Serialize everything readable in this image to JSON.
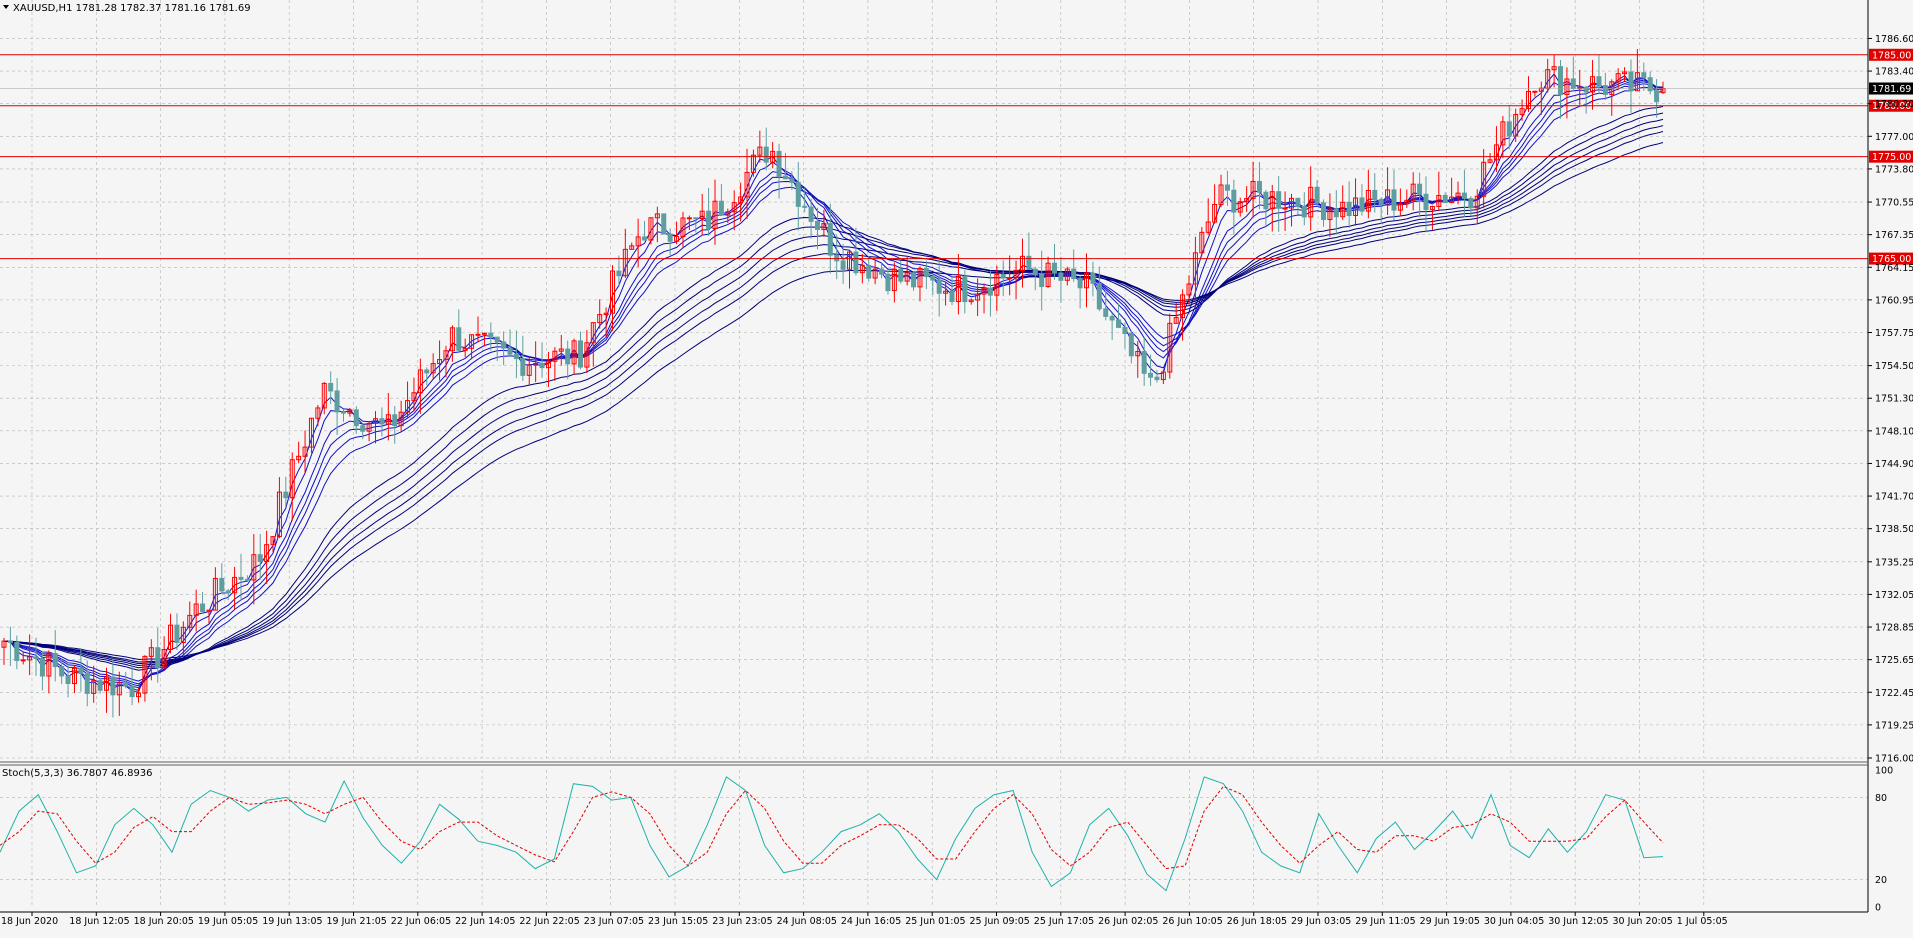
{
  "header": {
    "symbol_label": "XAUUSD,H1  1781.28 1782.37 1781.16 1781.69",
    "arrow_icon": "triangle-down-icon"
  },
  "colors": {
    "background": "#f5f5f5",
    "grid": "#b4b4b4",
    "bull": "#ff0000",
    "bear": "#5f9ea0",
    "ribbon": "#1010c8",
    "ribbon_dark": "#00007a",
    "level": "#e00000",
    "stoch_main": "#20b2aa",
    "stoch_signal": "#e00000",
    "axis": "#000000"
  },
  "chart_data": [
    {
      "type": "candlestick",
      "title": "XAUUSD,H1  1781.28 1782.37 1781.16 1781.69",
      "ohlc_last": {
        "open": 1781.28,
        "high": 1782.37,
        "low": 1781.16,
        "close": 1781.69
      },
      "ylim": [
        1716.0,
        1789.0
      ],
      "y_ticks": [
        "1786.60",
        "1783.40",
        "1780.20",
        "1777.00",
        "1773.80",
        "1770.55",
        "1767.35",
        "1764.15",
        "1760.95",
        "1757.75",
        "1754.50",
        "1751.30",
        "1748.10",
        "1744.90",
        "1741.70",
        "1738.50",
        "1735.25",
        "1732.05",
        "1728.85",
        "1725.65",
        "1722.45",
        "1719.25",
        "1716.00"
      ],
      "x_ticks": [
        "18 Jun 2020",
        "18 Jun 12:05",
        "18 Jun 20:05",
        "19 Jun 05:05",
        "19 Jun 13:05",
        "19 Jun 21:05",
        "22 Jun 06:05",
        "22 Jun 14:05",
        "22 Jun 22:05",
        "23 Jun 07:05",
        "23 Jun 15:05",
        "23 Jun 23:05",
        "24 Jun 08:05",
        "24 Jun 16:05",
        "25 Jun 01:05",
        "25 Jun 09:05",
        "25 Jun 17:05",
        "26 Jun 02:05",
        "26 Jun 10:05",
        "26 Jun 18:05",
        "29 Jun 03:05",
        "29 Jun 11:05",
        "29 Jun 19:05",
        "30 Jun 04:05",
        "30 Jun 12:05",
        "30 Jun 20:05",
        "1 Jul 05:05"
      ],
      "horizontal_levels": [
        {
          "price": 1785.0,
          "label": "1785.00"
        },
        {
          "price": 1780.0,
          "label": "1780.00"
        },
        {
          "price": 1775.0,
          "label": "1775.00"
        },
        {
          "price": 1765.0,
          "label": "1765.00"
        }
      ],
      "current_price": {
        "price": 1781.69,
        "label": "1781.69"
      },
      "path_points": [
        {
          "x": "18 Jun 2020",
          "y": 1727.5
        },
        {
          "x": "18 Jun 12:05",
          "y": 1724.0
        },
        {
          "x": "18 Jun 20:05",
          "y": 1723.0
        },
        {
          "x": "19 Jun 05:05",
          "y": 1730.5
        },
        {
          "x": "19 Jun 13:05",
          "y": 1735.5
        },
        {
          "x": "19 Jun 21:05",
          "y": 1752.0
        },
        {
          "x": "22 Jun 06:05",
          "y": 1748.0
        },
        {
          "x": "22 Jun 14:05",
          "y": 1757.5
        },
        {
          "x": "22 Jun 22:05",
          "y": 1755.0
        },
        {
          "x": "23 Jun 07:05",
          "y": 1755.5
        },
        {
          "x": "23 Jun 15:05",
          "y": 1768.0
        },
        {
          "x": "23 Jun 23:05",
          "y": 1768.5
        },
        {
          "x": "24 Jun 08:05",
          "y": 1776.0
        },
        {
          "x": "24 Jun 16:05",
          "y": 1766.0
        },
        {
          "x": "25 Jun 01:05",
          "y": 1763.0
        },
        {
          "x": "25 Jun 09:05",
          "y": 1762.0
        },
        {
          "x": "25 Jun 17:05",
          "y": 1764.0
        },
        {
          "x": "26 Jun 02:05",
          "y": 1762.0
        },
        {
          "x": "26 Jun 10:05",
          "y": 1752.0
        },
        {
          "x": "26 Jun 18:05",
          "y": 1771.0
        },
        {
          "x": "29 Jun 03:05",
          "y": 1771.0
        },
        {
          "x": "29 Jun 11:05",
          "y": 1770.0
        },
        {
          "x": "29 Jun 19:05",
          "y": 1771.0
        },
        {
          "x": "30 Jun 04:05",
          "y": 1771.5
        },
        {
          "x": "30 Jun 12:05",
          "y": 1783.0
        },
        {
          "x": "30 Jun 20:05",
          "y": 1782.0
        },
        {
          "x": "1 Jul 05:05",
          "y": 1781.69
        }
      ],
      "ribbon": "12 moving averages (blue)"
    },
    {
      "type": "line",
      "title": "Stoch(5,3,3) 36.7807 46.8936",
      "ylim": [
        0,
        100
      ],
      "y_ticks": [
        "100",
        "80",
        "20",
        "0"
      ],
      "series": [
        {
          "role": "main",
          "last": 36.7807,
          "values": [
            40,
            70,
            82,
            55,
            25,
            30,
            60,
            72,
            60,
            40,
            75,
            85,
            80,
            70,
            78,
            80,
            68,
            62,
            92,
            65,
            45,
            32,
            48,
            75,
            64,
            48,
            45,
            40,
            28,
            35,
            90,
            88,
            78,
            80,
            45,
            22,
            30,
            60,
            95,
            85,
            45,
            25,
            28,
            40,
            55,
            60,
            68,
            55,
            35,
            20,
            50,
            72,
            82,
            85,
            40,
            15,
            25,
            60,
            72,
            52,
            24,
            12,
            50,
            95,
            90,
            70,
            40,
            30,
            25,
            68,
            45,
            25,
            50,
            62,
            42,
            55,
            70,
            50,
            82,
            45,
            36,
            57,
            40,
            55,
            82,
            78,
            36,
            36.7807
          ]
        },
        {
          "role": "signal",
          "last": 46.8936,
          "values": [
            45,
            55,
            70,
            68,
            48,
            32,
            40,
            58,
            66,
            55,
            55,
            70,
            80,
            75,
            76,
            78,
            75,
            68,
            75,
            80,
            62,
            48,
            42,
            55,
            62,
            62,
            52,
            45,
            38,
            33,
            55,
            80,
            84,
            80,
            68,
            45,
            30,
            40,
            68,
            85,
            72,
            48,
            32,
            32,
            45,
            52,
            60,
            60,
            50,
            35,
            35,
            55,
            72,
            82,
            68,
            42,
            30,
            40,
            58,
            62,
            45,
            28,
            30,
            70,
            88,
            82,
            62,
            45,
            32,
            45,
            55,
            42,
            40,
            52,
            52,
            48,
            58,
            60,
            68,
            62,
            48,
            48,
            48,
            50,
            66,
            78,
            62,
            46.8936
          ]
        }
      ]
    }
  ]
}
